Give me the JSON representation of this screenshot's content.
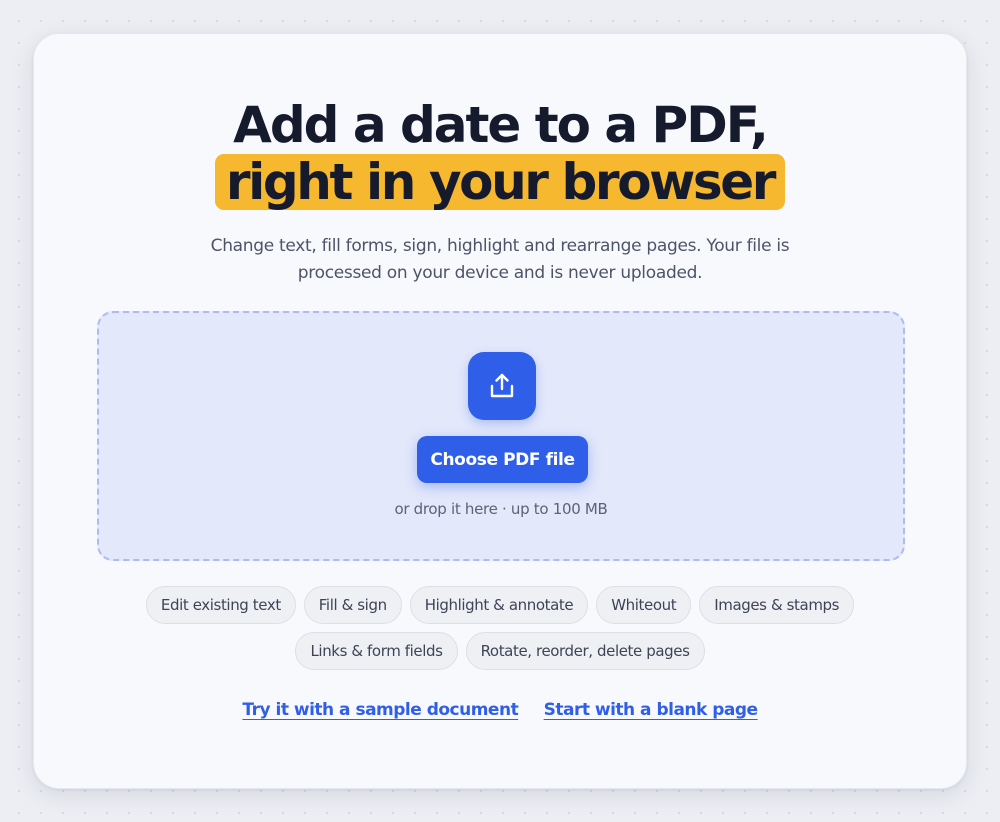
{
  "hero": {
    "title_line1": "Add a date to a PDF,",
    "title_line2": "right in your browser",
    "subtitle_line1": "Change text, fill forms, sign, highlight and rearrange pages. Your file is",
    "subtitle_line2": "processed on your device and is never uploaded."
  },
  "dropzone": {
    "upload_icon": "upload-icon",
    "choose_label": "Choose PDF file",
    "hint": "or drop it here · up to 100 MB"
  },
  "features": {
    "row1": [
      "Edit existing text",
      "Fill & sign",
      "Highlight & annotate",
      "Whiteout",
      "Images & stamps"
    ],
    "row2": [
      "Links & form fields",
      "Rotate, reorder, delete pages"
    ]
  },
  "links": {
    "sample": "Try it with a sample document",
    "blank": "Start with a blank page"
  },
  "colors": {
    "accent": "#2f5fe8",
    "highlight": "#f5b82e",
    "dropzone_bg": "#e3e8fa",
    "title": "#151a2d"
  }
}
